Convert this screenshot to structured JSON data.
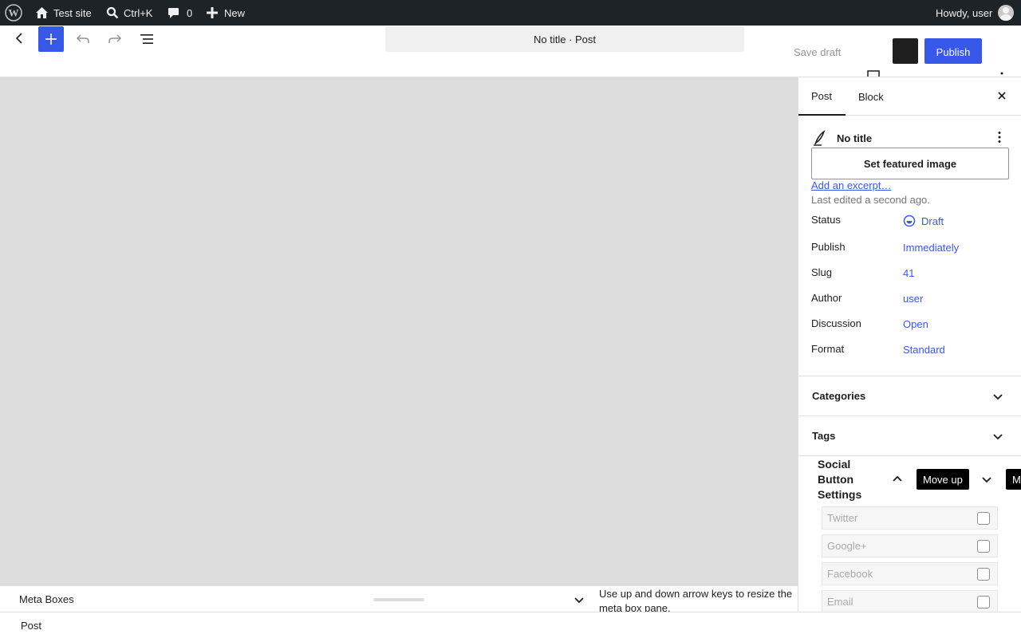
{
  "admin_bar": {
    "site_name": "Test site",
    "search_shortcut": "Ctrl+K",
    "comments_count": "0",
    "new_label": "New",
    "howdy": "Howdy, user"
  },
  "header": {
    "document_title": "No title · Post",
    "save_draft": "Save draft",
    "publish": "Publish"
  },
  "sidebar": {
    "tabs": [
      "Post",
      "Block"
    ],
    "post_title": "No title",
    "featured_image_button": "Set featured image",
    "excerpt_link": "Add an excerpt…",
    "last_edited": "Last edited a second ago.",
    "properties": [
      {
        "label": "Status",
        "value": "Draft"
      },
      {
        "label": "Publish",
        "value": "Immediately"
      },
      {
        "label": "Slug",
        "value": "41"
      },
      {
        "label": "Author",
        "value": "user"
      },
      {
        "label": "Discussion",
        "value": "Open"
      },
      {
        "label": "Format",
        "value": "Standard"
      }
    ],
    "panels": [
      "Categories",
      "Tags"
    ],
    "social": {
      "title": "Social Button Settings",
      "tooltip_move_up": "Move up",
      "tooltip_partial": "M",
      "fields": [
        "Twitter",
        "Google+",
        "Facebook",
        "Email"
      ]
    }
  },
  "meta_boxes": {
    "title": "Meta Boxes",
    "help": "Use up and down arrow keys to resize the meta box pane."
  },
  "footer": {
    "breadcrumb": "Post"
  },
  "colors": {
    "accent": "#3858e9",
    "admin_bar": "#1d2327",
    "canvas": "#dddddd"
  }
}
